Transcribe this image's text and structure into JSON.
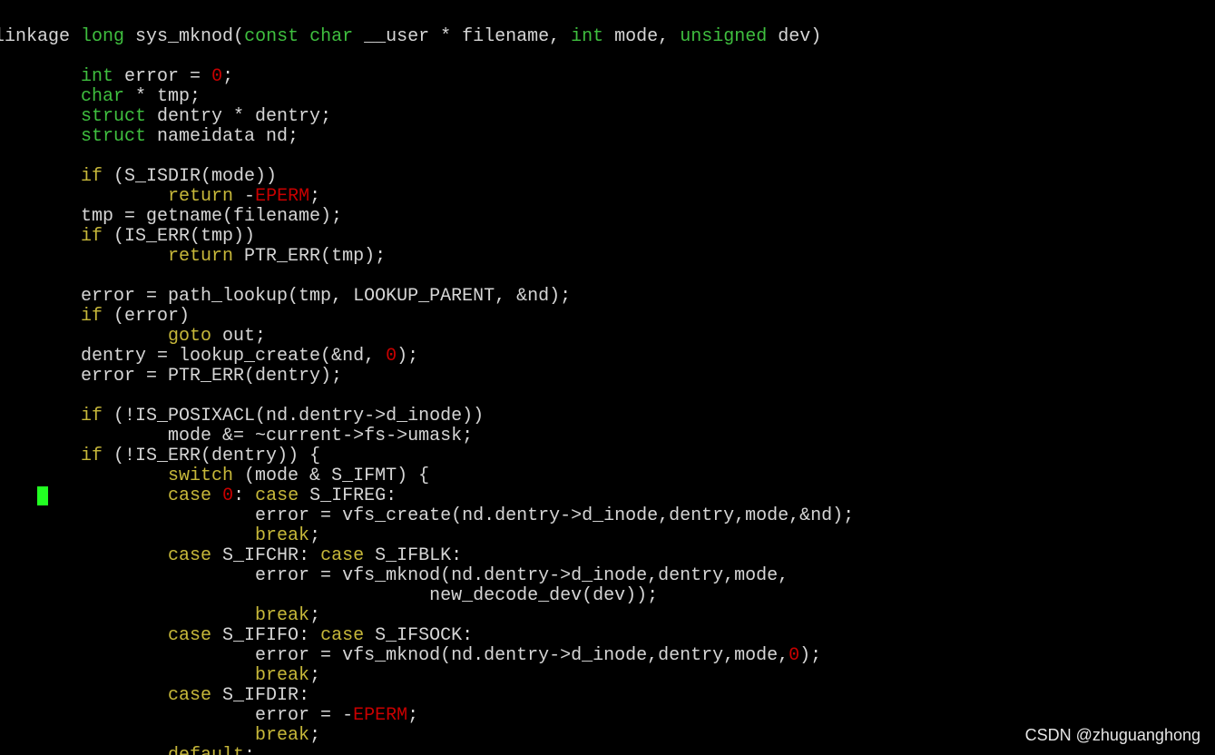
{
  "terminal": {
    "watermark": "CSDN @zhuguanghong",
    "colors": {
      "background": "#000000",
      "text": "#d6d6d6",
      "type_keyword": "#3fbf3f",
      "control_keyword": "#c7b83a",
      "constant": "#c80000",
      "cursor": "#22ff22"
    }
  },
  "code": {
    "lines": [
      [
        [
          "linkage ",
          "txt"
        ],
        [
          "long",
          "kw"
        ],
        [
          " sys_mknod(",
          "txt"
        ],
        [
          "const",
          "kw"
        ],
        [
          " ",
          "txt"
        ],
        [
          "char",
          "kw"
        ],
        [
          " __user * filename, ",
          "txt"
        ],
        [
          "int",
          "kw"
        ],
        [
          " mode, ",
          "txt"
        ],
        [
          "unsigned",
          "kw"
        ],
        [
          " dev)",
          "txt"
        ]
      ],
      [],
      [
        [
          "        ",
          "txt"
        ],
        [
          "int",
          "kw"
        ],
        [
          " error = ",
          "txt"
        ],
        [
          "0",
          "num"
        ],
        [
          ";",
          "txt"
        ]
      ],
      [
        [
          "        ",
          "txt"
        ],
        [
          "char",
          "kw"
        ],
        [
          " * tmp;",
          "txt"
        ]
      ],
      [
        [
          "        ",
          "txt"
        ],
        [
          "struct",
          "kw"
        ],
        [
          " dentry * dentry;",
          "txt"
        ]
      ],
      [
        [
          "        ",
          "txt"
        ],
        [
          "struct",
          "kw"
        ],
        [
          " nameidata nd;",
          "txt"
        ]
      ],
      [],
      [
        [
          "        ",
          "txt"
        ],
        [
          "if",
          "ctl"
        ],
        [
          " (S_ISDIR(mode))",
          "txt"
        ]
      ],
      [
        [
          "                ",
          "txt"
        ],
        [
          "return",
          "ctl"
        ],
        [
          " -",
          "txt"
        ],
        [
          "EPERM",
          "mac"
        ],
        [
          ";",
          "txt"
        ]
      ],
      [
        [
          "        tmp = getname(filename);",
          "txt"
        ]
      ],
      [
        [
          "        ",
          "txt"
        ],
        [
          "if",
          "ctl"
        ],
        [
          " (IS_ERR(tmp))",
          "txt"
        ]
      ],
      [
        [
          "                ",
          "txt"
        ],
        [
          "return",
          "ctl"
        ],
        [
          " PTR_ERR(tmp);",
          "txt"
        ]
      ],
      [],
      [
        [
          "        error = path_lookup(tmp, LOOKUP_PARENT, &nd);",
          "txt"
        ]
      ],
      [
        [
          "        ",
          "txt"
        ],
        [
          "if",
          "ctl"
        ],
        [
          " (error)",
          "txt"
        ]
      ],
      [
        [
          "                ",
          "txt"
        ],
        [
          "goto",
          "ctl"
        ],
        [
          " out;",
          "txt"
        ]
      ],
      [
        [
          "        dentry = lookup_create(&nd, ",
          "txt"
        ],
        [
          "0",
          "num"
        ],
        [
          ");",
          "txt"
        ]
      ],
      [
        [
          "        error = PTR_ERR(dentry);",
          "txt"
        ]
      ],
      [],
      [
        [
          "        ",
          "txt"
        ],
        [
          "if",
          "ctl"
        ],
        [
          " (!IS_POSIXACL(nd.dentry->d_inode))",
          "txt"
        ]
      ],
      [
        [
          "                mode &= ~current->fs->umask;",
          "txt"
        ]
      ],
      [
        [
          "        ",
          "txt"
        ],
        [
          "if",
          "ctl"
        ],
        [
          " (!IS_ERR(dentry)) {",
          "txt"
        ]
      ],
      [
        [
          "                ",
          "txt"
        ],
        [
          "switch",
          "ctl"
        ],
        [
          " (mode & S_IFMT) {",
          "txt"
        ]
      ],
      [
        [
          "                ",
          "txt"
        ],
        [
          "case",
          "ctl"
        ],
        [
          " ",
          "txt"
        ],
        [
          "0",
          "num"
        ],
        [
          ": ",
          "txt"
        ],
        [
          "case",
          "ctl"
        ],
        [
          " S_IFREG:",
          "txt"
        ]
      ],
      [
        [
          "                        error = vfs_create(nd.dentry->d_inode,dentry,mode,&nd);",
          "txt"
        ]
      ],
      [
        [
          "                        ",
          "txt"
        ],
        [
          "break",
          "ctl"
        ],
        [
          ";",
          "txt"
        ]
      ],
      [
        [
          "                ",
          "txt"
        ],
        [
          "case",
          "ctl"
        ],
        [
          " S_IFCHR: ",
          "txt"
        ],
        [
          "case",
          "ctl"
        ],
        [
          " S_IFBLK:",
          "txt"
        ]
      ],
      [
        [
          "                        error = vfs_mknod(nd.dentry->d_inode,dentry,mode,",
          "txt"
        ]
      ],
      [
        [
          "                                        new_decode_dev(dev));",
          "txt"
        ]
      ],
      [
        [
          "                        ",
          "txt"
        ],
        [
          "break",
          "ctl"
        ],
        [
          ";",
          "txt"
        ]
      ],
      [
        [
          "                ",
          "txt"
        ],
        [
          "case",
          "ctl"
        ],
        [
          " S_IFIFO: ",
          "txt"
        ],
        [
          "case",
          "ctl"
        ],
        [
          " S_IFSOCK:",
          "txt"
        ]
      ],
      [
        [
          "                        error = vfs_mknod(nd.dentry->d_inode,dentry,mode,",
          "txt"
        ],
        [
          "0",
          "num"
        ],
        [
          ");",
          "txt"
        ]
      ],
      [
        [
          "                        ",
          "txt"
        ],
        [
          "break",
          "ctl"
        ],
        [
          ";",
          "txt"
        ]
      ],
      [
        [
          "                ",
          "txt"
        ],
        [
          "case",
          "ctl"
        ],
        [
          " S_IFDIR:",
          "txt"
        ]
      ],
      [
        [
          "                        error = -",
          "txt"
        ],
        [
          "EPERM",
          "mac"
        ],
        [
          ";",
          "txt"
        ]
      ],
      [
        [
          "                        ",
          "txt"
        ],
        [
          "break",
          "ctl"
        ],
        [
          ";",
          "txt"
        ]
      ],
      [
        [
          "                ",
          "txt"
        ],
        [
          "default",
          "ctl"
        ],
        [
          ":",
          "txt"
        ]
      ]
    ]
  }
}
